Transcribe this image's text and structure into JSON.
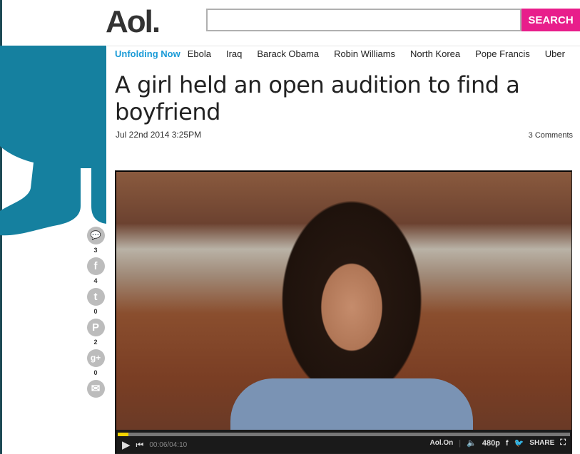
{
  "header": {
    "logo": "Aol.",
    "search_placeholder": "",
    "search_button": "SEARCH",
    "accent": "#e81e8b"
  },
  "nav": {
    "highlight": "Unfolding Now",
    "items": [
      "Ebola",
      "Iraq",
      "Barack Obama",
      "Robin Williams",
      "North Korea",
      "Pope Francis",
      "Uber"
    ]
  },
  "article": {
    "title": "A girl held an open audition to find a boyfriend",
    "date": "Jul 22nd 2014 3:25PM",
    "comments": "3 Comments"
  },
  "share": [
    {
      "icon": "comment-icon",
      "glyph": "💬",
      "count": "3"
    },
    {
      "icon": "facebook-icon",
      "glyph": "f",
      "count": "4"
    },
    {
      "icon": "twitter-icon",
      "glyph": "t",
      "count": "0"
    },
    {
      "icon": "pinterest-icon",
      "glyph": "P",
      "count": "2"
    },
    {
      "icon": "google-plus-icon",
      "glyph": "g+",
      "count": "0"
    },
    {
      "icon": "email-icon",
      "glyph": "✉",
      "count": ""
    }
  ],
  "video": {
    "time": "00:06/04:10",
    "progress_percent": 2.4,
    "brand": "Aol.On",
    "quality": "480p",
    "share": "SHARE"
  }
}
